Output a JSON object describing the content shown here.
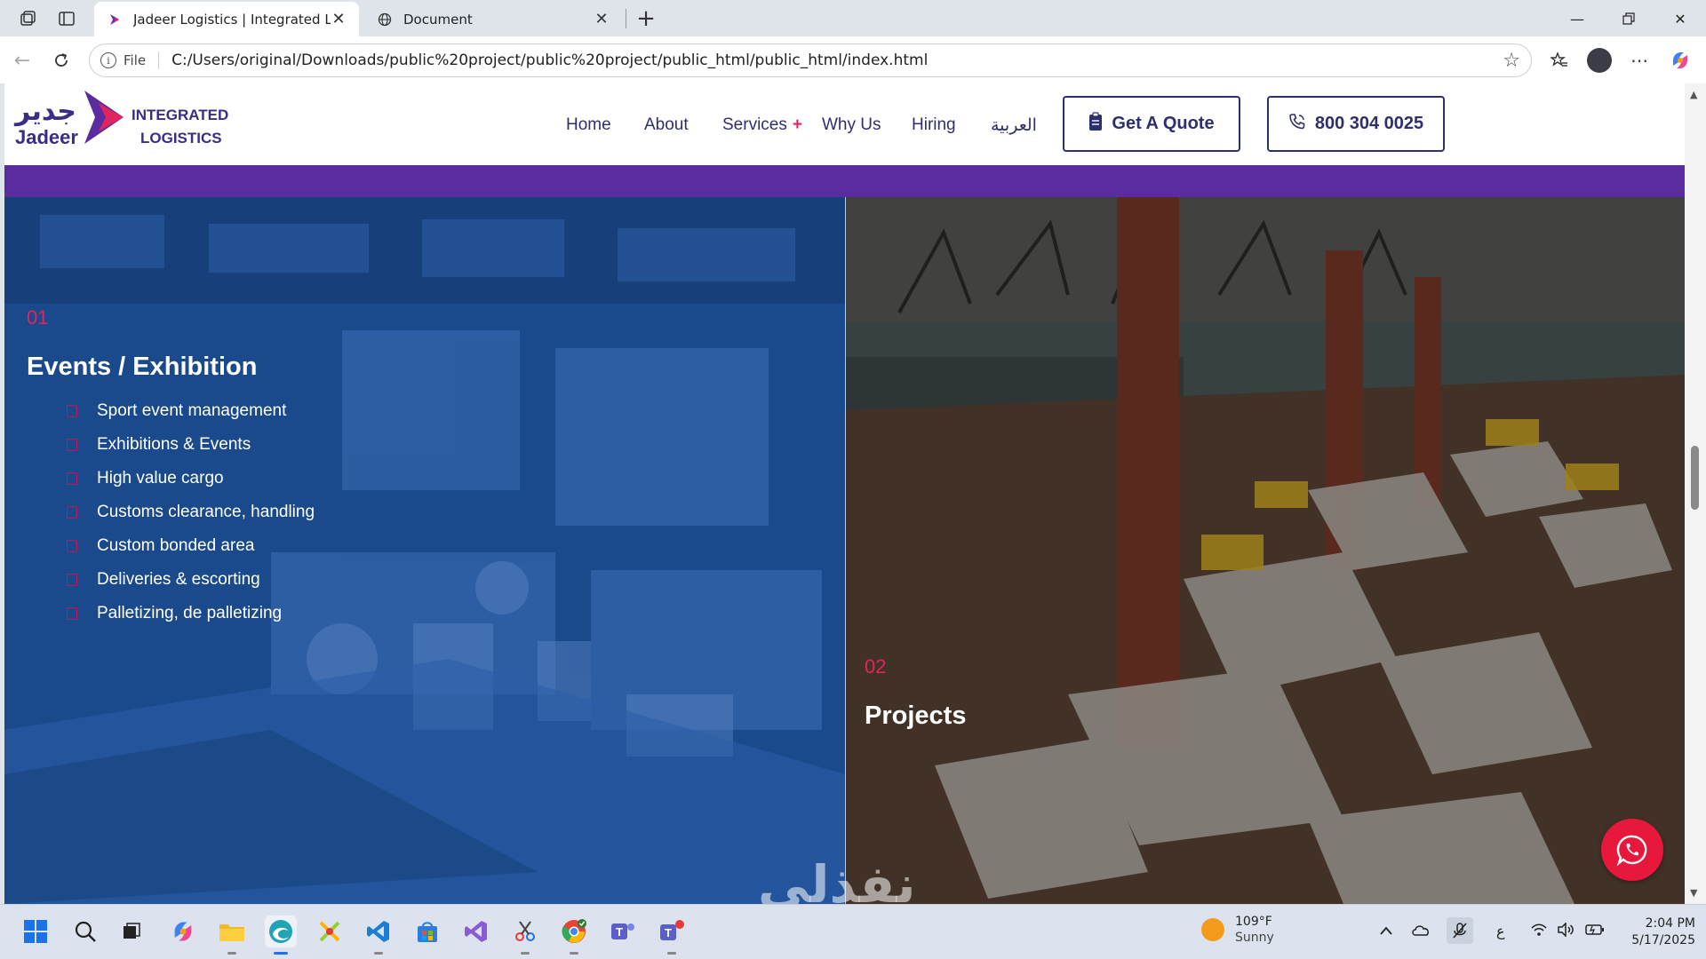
{
  "browser": {
    "tabs": [
      {
        "title": "Jadeer Logistics | Integrated Logis",
        "active": true
      },
      {
        "title": "Document",
        "active": false
      }
    ],
    "address": {
      "scheme_label": "File",
      "url": "C:/Users/original/Downloads/public%20project/public%20project/public_html/public_html/index.html"
    }
  },
  "site": {
    "logo": {
      "arabic": "جدير",
      "latin": "Jadeer",
      "line1": "INTEGRATED",
      "line2": "LOGISTICS"
    },
    "nav": [
      {
        "label": "Home"
      },
      {
        "label": "About"
      },
      {
        "label": "Services",
        "plus": "+"
      },
      {
        "label": "Why Us"
      },
      {
        "label": "Hiring"
      },
      {
        "label": "العربية"
      }
    ],
    "quote_button": "Get A Quote",
    "phone_button": "800 304 0025",
    "colors": {
      "brand_purple": "#5b2c9f",
      "accent_pink": "#e0245e",
      "navy": "#2e2f6e"
    }
  },
  "panels": [
    {
      "number": "01",
      "title": "Events / Exhibition",
      "items": [
        "Sport event management",
        "Exhibitions & Events",
        "High value cargo",
        "Customs clearance, handling",
        "Custom bonded area",
        "Deliveries & escorting",
        "Palletizing, de palletizing"
      ]
    },
    {
      "number": "02",
      "title": "Projects"
    }
  ],
  "watermark": "نفذلي",
  "taskbar": {
    "weather": {
      "temp": "109°F",
      "condition": "Sunny"
    },
    "lang": "ع",
    "time": "2:04 PM",
    "date": "5/17/2025"
  }
}
